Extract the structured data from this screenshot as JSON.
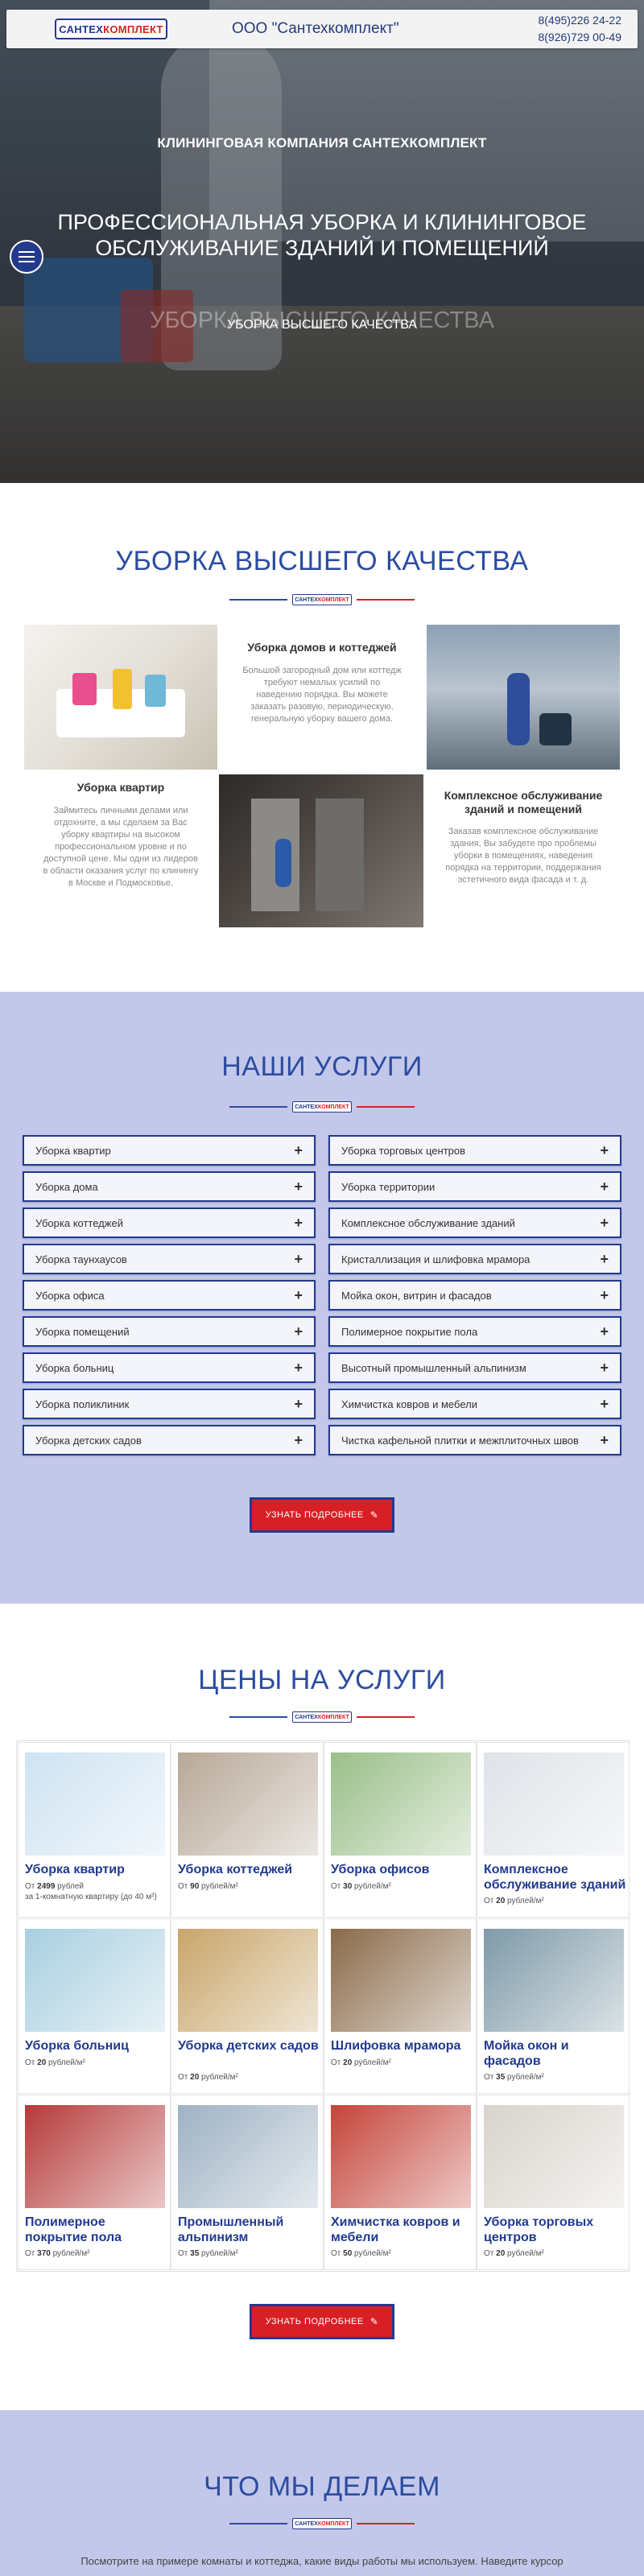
{
  "header": {
    "logo_left": "САНТЕХ",
    "logo_right": "КОМПЛЕКТ",
    "company": "ООО \"Сантехкомплект\"",
    "phone1": "8(495)226 24-22",
    "phone2": "8(926)729 00-49"
  },
  "hero": {
    "kicker": "КЛИНИНГОВАЯ КОМПАНИЯ САНТЕХКОМПЛЕКТ",
    "title": "ПРОФЕССИОНАЛЬНАЯ УБОРКА И КЛИНИНГОВОЕ ОБСЛУЖИВАНИЕ ЗДАНИЙ И ПОМЕЩЕНИЙ",
    "ghost": "УБОРКА ВЫСШЕГО КАЧЕСТВА",
    "subtitle": "УБОРКА ВЫСШЕГО КАЧЕСТВА",
    "menu_icon": "hamburger-icon"
  },
  "quality": {
    "title": "УБОРКА ВЫСШЕГО КАЧЕСТВА",
    "cards": [
      {
        "title": "Уборка домов и коттеджей",
        "text": "Большой загородный дом или коттедж требуют немалых усилий по наведению порядка. Вы можете заказать разовую, периодическую, генеральную уборку вашего дома."
      },
      {
        "title": "Уборка квартир",
        "text": "Займитесь личными делами или отдохните, а мы сделаем за Вас уборку квартиры на высоком профессиональном уровне и по доступной цене. Мы одни из лидеров в области оказания услуг по клинингу в Москве и Подмосковье."
      },
      {
        "title": "Комплексное обслуживание зданий и помещений",
        "text": "Заказав комплексное обслуживание здания, Вы забудете про проблемы уборки в помещениях, наведения порядка на территории, поддержания эстетичного вида фасада и т. д."
      }
    ]
  },
  "services": {
    "title": "НАШИ УСЛУГИ",
    "left": [
      "Уборка квартир",
      "Уборка дома",
      "Уборка коттеджей",
      "Уборка таунхаусов",
      "Уборка офиса",
      "Уборка помещений",
      "Уборка больниц",
      "Уборка поликлиник",
      "Уборка детских садов"
    ],
    "right": [
      "Уборка торговых центров",
      "Уборка территории",
      "Комплексное обслуживание зданий",
      "Кристаллизация и шлифовка мрамора",
      "Мойка окон, витрин и фасадов",
      "Полимерное покрытие пола",
      "Высотный промышленный альпинизм",
      "Химчистка ковров и мебели",
      "Чистка кафельной плитки и межплиточных швов"
    ],
    "plus": "+",
    "button": "УЗНАТЬ ПОДРОБНЕЕ"
  },
  "prices": {
    "title": "ЦЕНЫ НА УСЛУГИ",
    "button": "УЗНАТЬ ПОДРОБНЕЕ",
    "items": [
      {
        "name": "Уборка квартир",
        "prefix": "От",
        "price": "2499",
        "unit": "рублей",
        "extra": "за 1-комнатную квартиру (до 40 м²)",
        "color": "#cfe3f2"
      },
      {
        "name": "Уборка коттеджей",
        "prefix": "От",
        "price": "90",
        "unit": "рублей/м²",
        "extra": "",
        "color": "#b7a898"
      },
      {
        "name": "Уборка офисов",
        "prefix": "От",
        "price": "30",
        "unit": "рублей/м²",
        "extra": "",
        "color": "#9bbf8a"
      },
      {
        "name": "Комплексное обслуживание зданий",
        "prefix": "От",
        "price": "20",
        "unit": "рублей/м²",
        "extra": "",
        "color": "#dfe3e8"
      },
      {
        "name": "Уборка больниц",
        "prefix": "От",
        "price": "20",
        "unit": "рублей/м²",
        "extra": "",
        "color": "#a9cfe0"
      },
      {
        "name": "Уборка детских садов",
        "prefix": "От",
        "price": "20",
        "unit": "рублей/м²",
        "extra": "",
        "color": "#c8a56a"
      },
      {
        "name": "Шлифовка мрамора",
        "prefix": "От",
        "price": "20",
        "unit": "рублей/м²",
        "extra": "",
        "color": "#8a6a4a"
      },
      {
        "name": "Мойка окон и фасадов",
        "prefix": "От",
        "price": "35",
        "unit": "рублей/м²",
        "extra": "",
        "color": "#7f9aa8"
      },
      {
        "name": "Полимерное покрытие пола",
        "prefix": "От",
        "price": "370",
        "unit": "рублей/м²",
        "extra": "",
        "color": "#b53a3a"
      },
      {
        "name": "Промышленный альпинизм",
        "prefix": "От",
        "price": "35",
        "unit": "рублей/м²",
        "extra": "",
        "color": "#9fb2c4"
      },
      {
        "name": "Химчистка ковров и мебели",
        "prefix": "От",
        "price": "50",
        "unit": "рублей/м²",
        "extra": "",
        "color": "#c4443a"
      },
      {
        "name": "Уборка торговых центров",
        "prefix": "От",
        "price": "20",
        "unit": "рублей/м²",
        "extra": "",
        "color": "#d8d4cc"
      }
    ]
  },
  "whatwedo": {
    "title": "ЧТО МЫ ДЕЛАЕМ",
    "text": "Посмотрите на примере комнаты и коттеджа, какие виды работы мы используем. Наведите курсор"
  }
}
